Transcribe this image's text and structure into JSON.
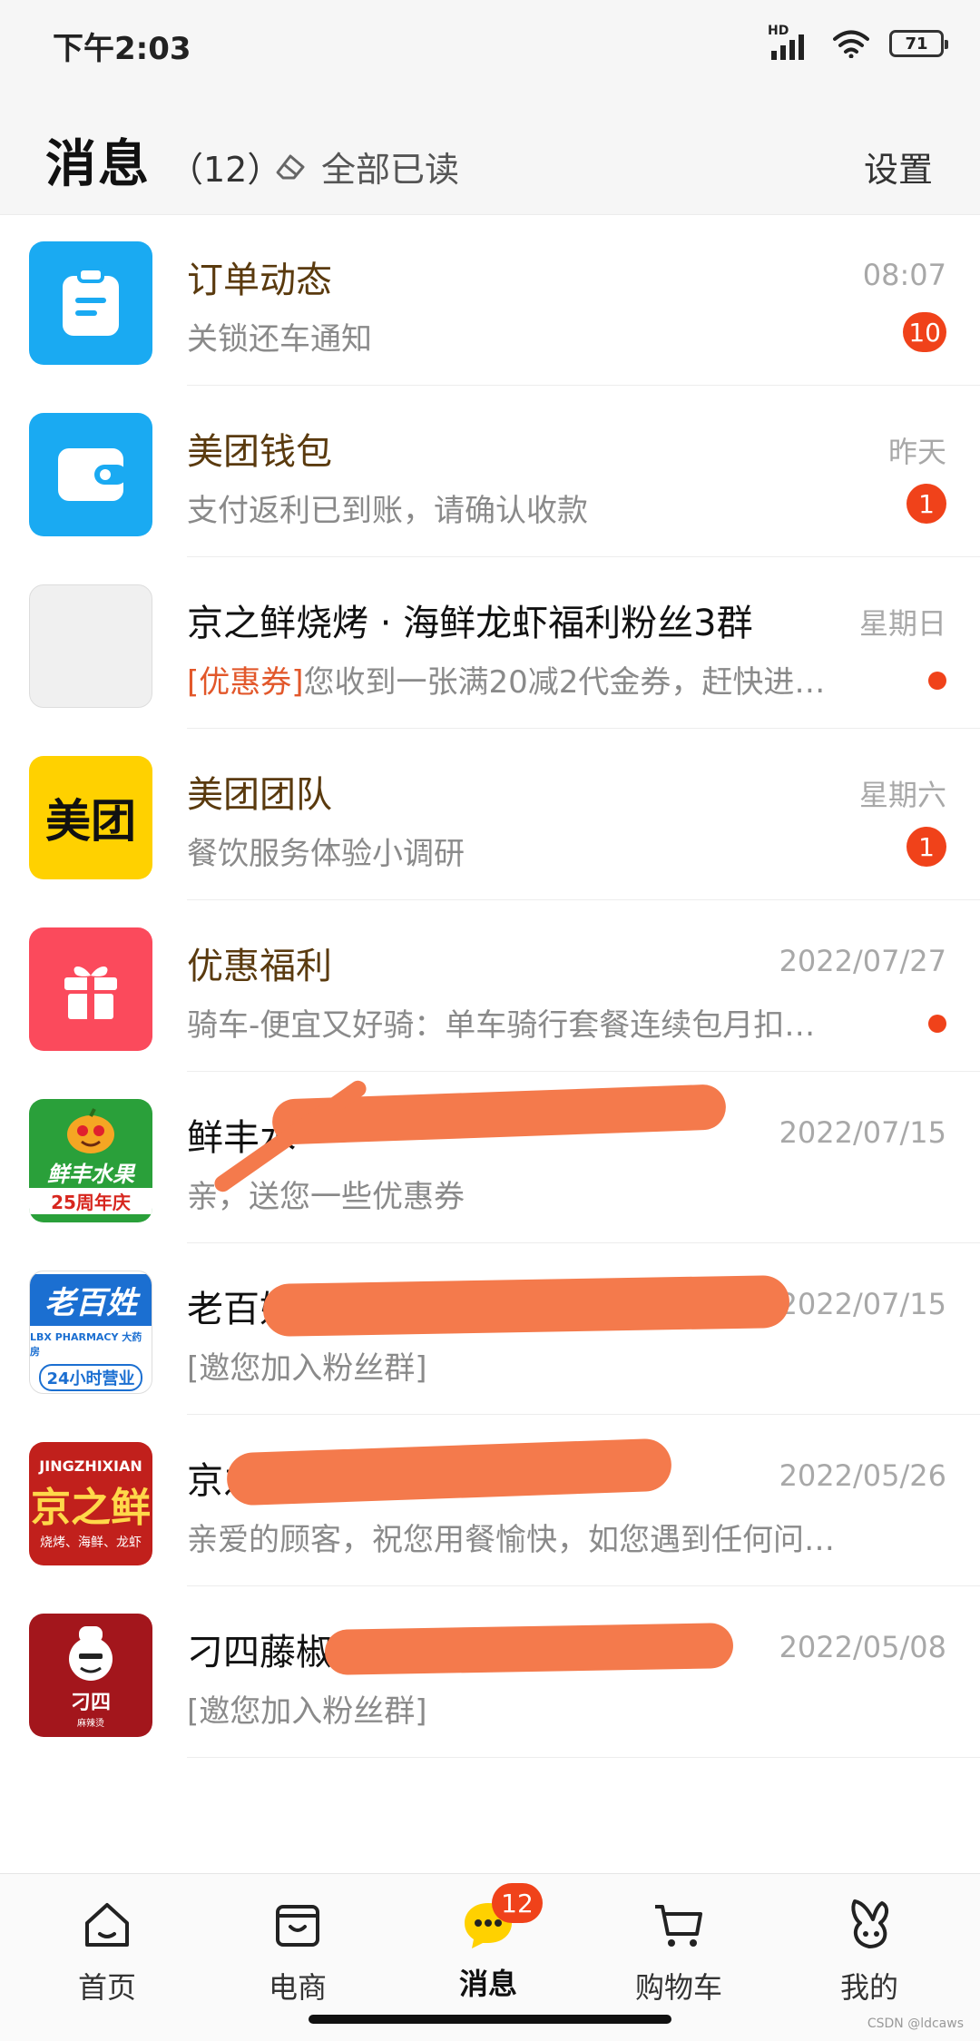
{
  "status": {
    "time": "下午2:03",
    "network": "HD",
    "battery": "71"
  },
  "header": {
    "title": "消息",
    "count": "（12）",
    "mark_all_read": "全部已读",
    "settings": "设置"
  },
  "conversations": [
    {
      "name": "订单动态",
      "time": "08:07",
      "preview": "关锁还车通知",
      "badge": "10",
      "avatar_color": "#1aaaf2"
    },
    {
      "name": "美团钱包",
      "time": "昨天",
      "preview": "支付返利已到账，请确认收款",
      "badge": "1",
      "avatar_color": "#1aaaf2"
    },
    {
      "name": "京之鲜烧烤 · 海鲜龙虾福利粉丝3群",
      "time": "星期日",
      "tag": "[优惠券]",
      "preview": "您收到一张满20减2代金券，赶快进…",
      "dot": true
    },
    {
      "name": "美团团队",
      "time": "星期六",
      "preview": "餐饮服务体验小调研",
      "badge": "1",
      "avatar_text": "美团",
      "avatar_color": "#ffd100"
    },
    {
      "name": "优惠福利",
      "time": "2022/07/27",
      "preview": "骑车-便宜又好骑：单车骑行套餐连续包月扣…",
      "dot": true,
      "avatar_color": "#fb4a5c"
    },
    {
      "name": "鲜丰水",
      "time": "2022/07/15",
      "preview": "亲，送您一些优惠券",
      "avatar_text": "鲜丰水果",
      "avatar_sub": "25周年庆"
    },
    {
      "name": "老百姓大药",
      "time": "2022/07/15",
      "preview": "[邀您加入粉丝群]",
      "avatar_text": "老百姓",
      "avatar_sub": "24小时营业",
      "avatar_mid": "LBX PHARMACY 大药房"
    },
    {
      "name": "京之鲜",
      "time": "2022/05/26",
      "preview": "亲爱的顾客，祝您用餐愉快，如您遇到任何问…",
      "avatar_text": "京之鲜",
      "avatar_top": "JINGZHIXIAN",
      "avatar_sub": "烧烤、海鲜、龙虾"
    },
    {
      "name": "刁四藤椒麻辣烫",
      "time": "2022/05/08",
      "preview": "[邀您加入粉丝群]",
      "avatar_text": "刁四",
      "avatar_sub": "麻辣烫"
    }
  ],
  "nav": [
    {
      "label": "首页"
    },
    {
      "label": "电商"
    },
    {
      "label": "消息",
      "badge": "12",
      "active": true
    },
    {
      "label": "购物车"
    },
    {
      "label": "我的"
    }
  ],
  "watermark": "CSDN @ldcaws"
}
